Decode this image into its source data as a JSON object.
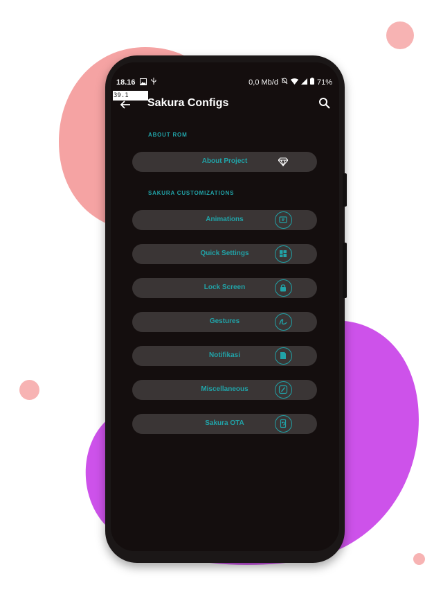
{
  "colors": {
    "accent": "#21a3a8",
    "screen": "#140e0e",
    "item_bg": "#3a3535",
    "pink": "#f5a3a3",
    "purple": "#cd52ea"
  },
  "status_bar": {
    "time": "18.16",
    "speed": "0,0 Mb/d",
    "battery": "71%"
  },
  "debug_overlay": "39.1",
  "app_bar": {
    "title": "Sakura Configs",
    "back_icon": "arrow-left-icon",
    "search_icon": "search-icon"
  },
  "sections": [
    {
      "label": "ABOUT ROM",
      "items": [
        {
          "label": "About Project",
          "icon": "diamond-icon"
        }
      ]
    },
    {
      "label": "SAKURA CUSTOMIZATIONS",
      "items": [
        {
          "label": "Animations",
          "icon": "animation-icon"
        },
        {
          "label": "Quick Settings",
          "icon": "grid-icon"
        },
        {
          "label": "Lock Screen",
          "icon": "lock-icon"
        },
        {
          "label": "Gestures",
          "icon": "gesture-icon"
        },
        {
          "label": "Notifikasi",
          "icon": "notification-icon"
        },
        {
          "label": "Miscellaneous",
          "icon": "misc-icon"
        },
        {
          "label": "Sakura OTA",
          "icon": "update-icon"
        }
      ]
    }
  ]
}
